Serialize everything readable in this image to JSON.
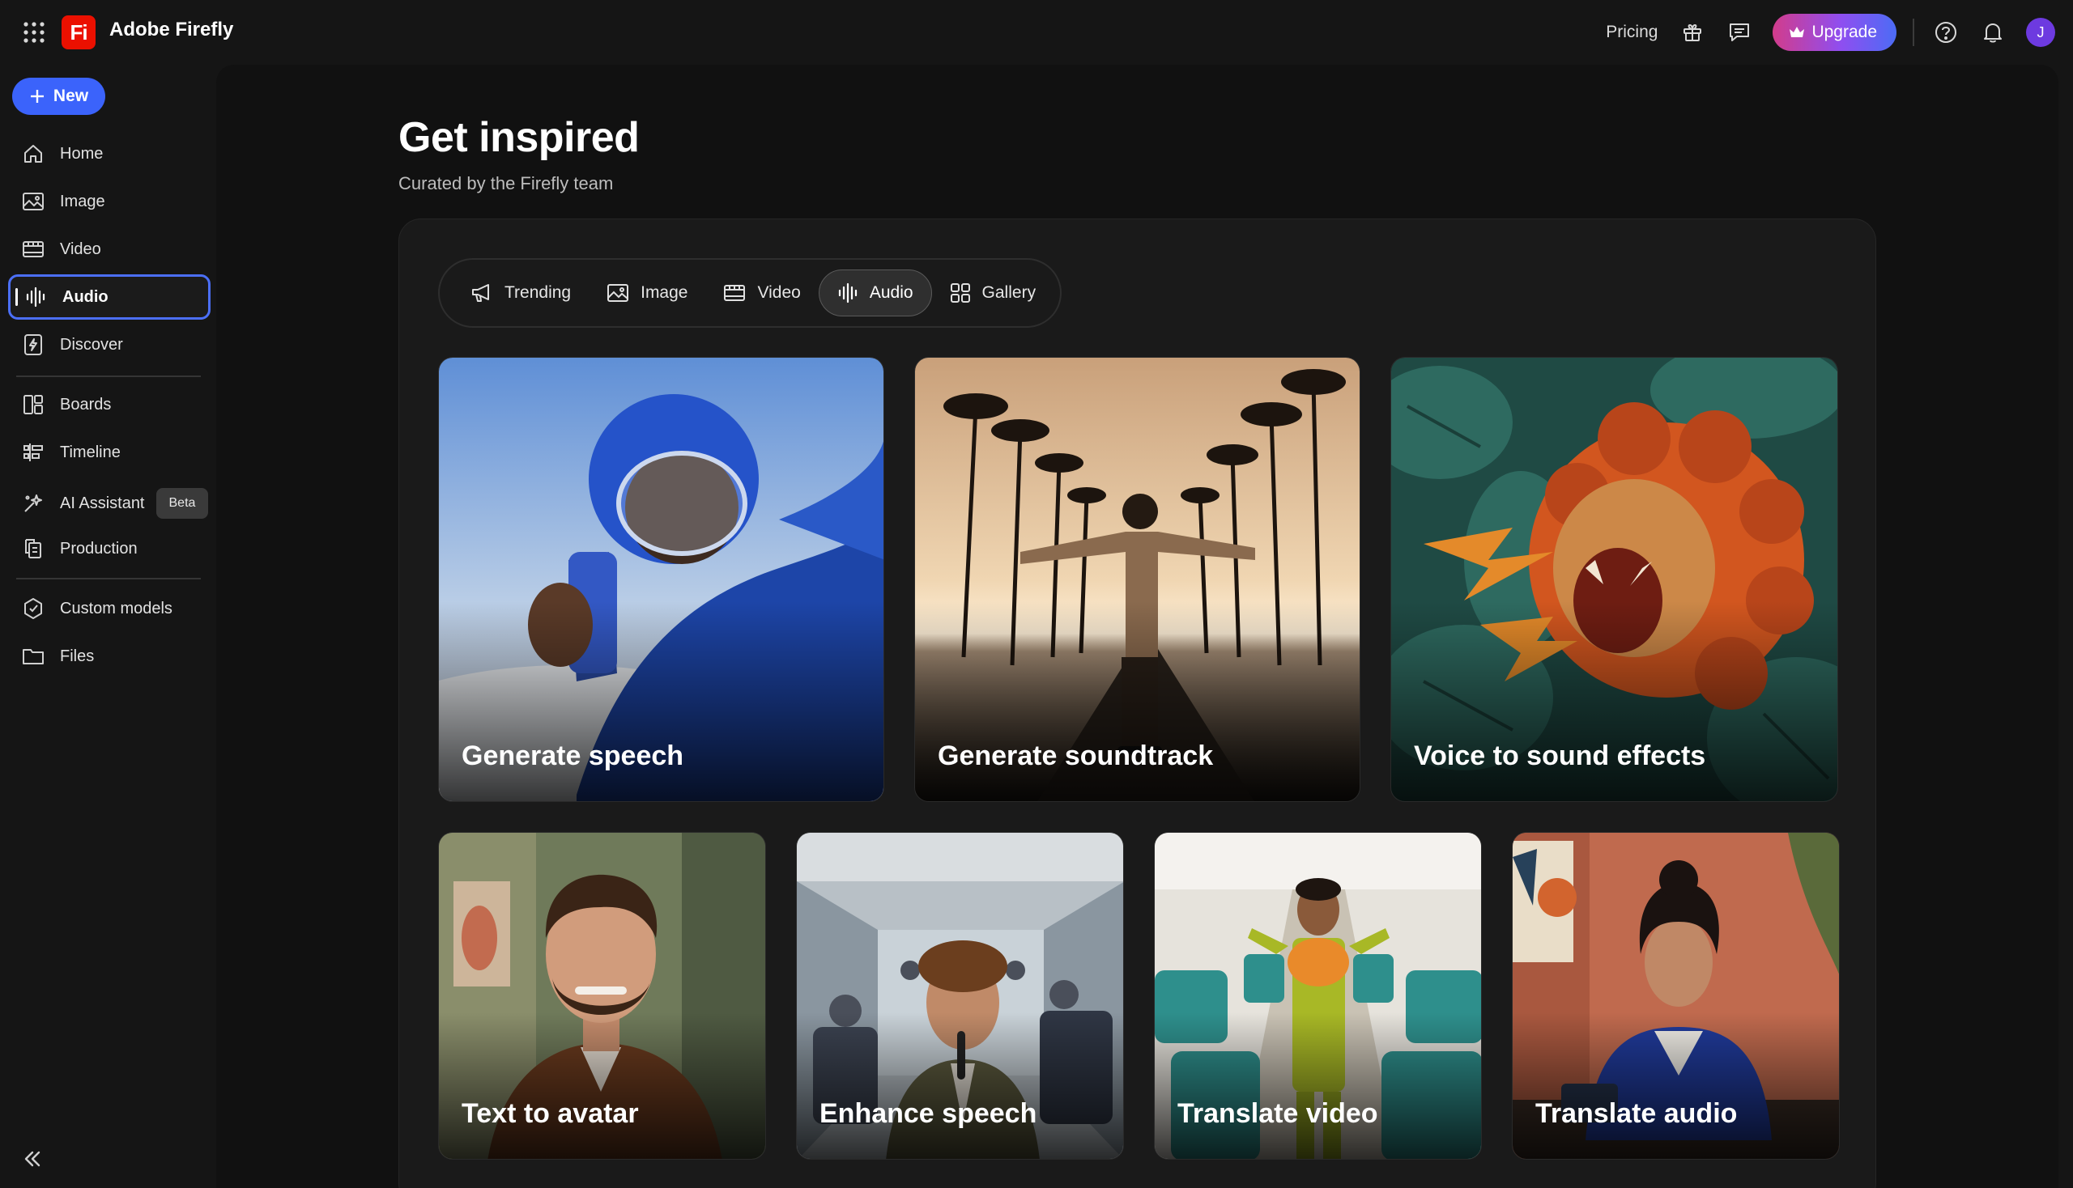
{
  "app": {
    "title": "Adobe Firefly",
    "logo_text": "Fi"
  },
  "topbar": {
    "pricing": "Pricing",
    "upgrade": "Upgrade",
    "avatar_initial": "J",
    "icons": [
      "gift-icon",
      "feedback-icon",
      "help-icon",
      "notifications-icon"
    ]
  },
  "sidebar": {
    "new_label": "New",
    "items": [
      {
        "label": "Home",
        "icon": "home-icon"
      },
      {
        "label": "Image",
        "icon": "image-icon"
      },
      {
        "label": "Video",
        "icon": "video-icon"
      },
      {
        "label": "Audio",
        "icon": "audio-icon",
        "active": true
      },
      {
        "label": "Discover",
        "icon": "discover-icon"
      },
      {
        "label": "Boards",
        "icon": "boards-icon"
      },
      {
        "label": "Timeline",
        "icon": "timeline-icon"
      },
      {
        "label": "AI Assistant",
        "icon": "ai-assistant-icon",
        "badge": "Beta"
      },
      {
        "label": "Production",
        "icon": "production-icon"
      },
      {
        "label": "Custom models",
        "icon": "custom-models-icon"
      },
      {
        "label": "Files",
        "icon": "files-icon"
      }
    ]
  },
  "main": {
    "title": "Get inspired",
    "subtitle": "Curated by the Firefly team",
    "tabs": [
      {
        "label": "Trending",
        "icon": "megaphone-icon"
      },
      {
        "label": "Image",
        "icon": "image-icon"
      },
      {
        "label": "Video",
        "icon": "video-icon"
      },
      {
        "label": "Audio",
        "icon": "audio-icon",
        "active": true
      },
      {
        "label": "Gallery",
        "icon": "gallery-icon"
      }
    ],
    "cards": [
      {
        "label": "Generate speech"
      },
      {
        "label": "Generate soundtrack"
      },
      {
        "label": "Voice to sound effects"
      },
      {
        "label": "Text to avatar"
      },
      {
        "label": "Enhance speech"
      },
      {
        "label": "Translate video"
      },
      {
        "label": "Translate audio"
      }
    ]
  },
  "colors": {
    "accent": "#3b63fb",
    "active_outline": "#4b6ff7",
    "logo_red": "#eb1000",
    "background": "#151515"
  }
}
